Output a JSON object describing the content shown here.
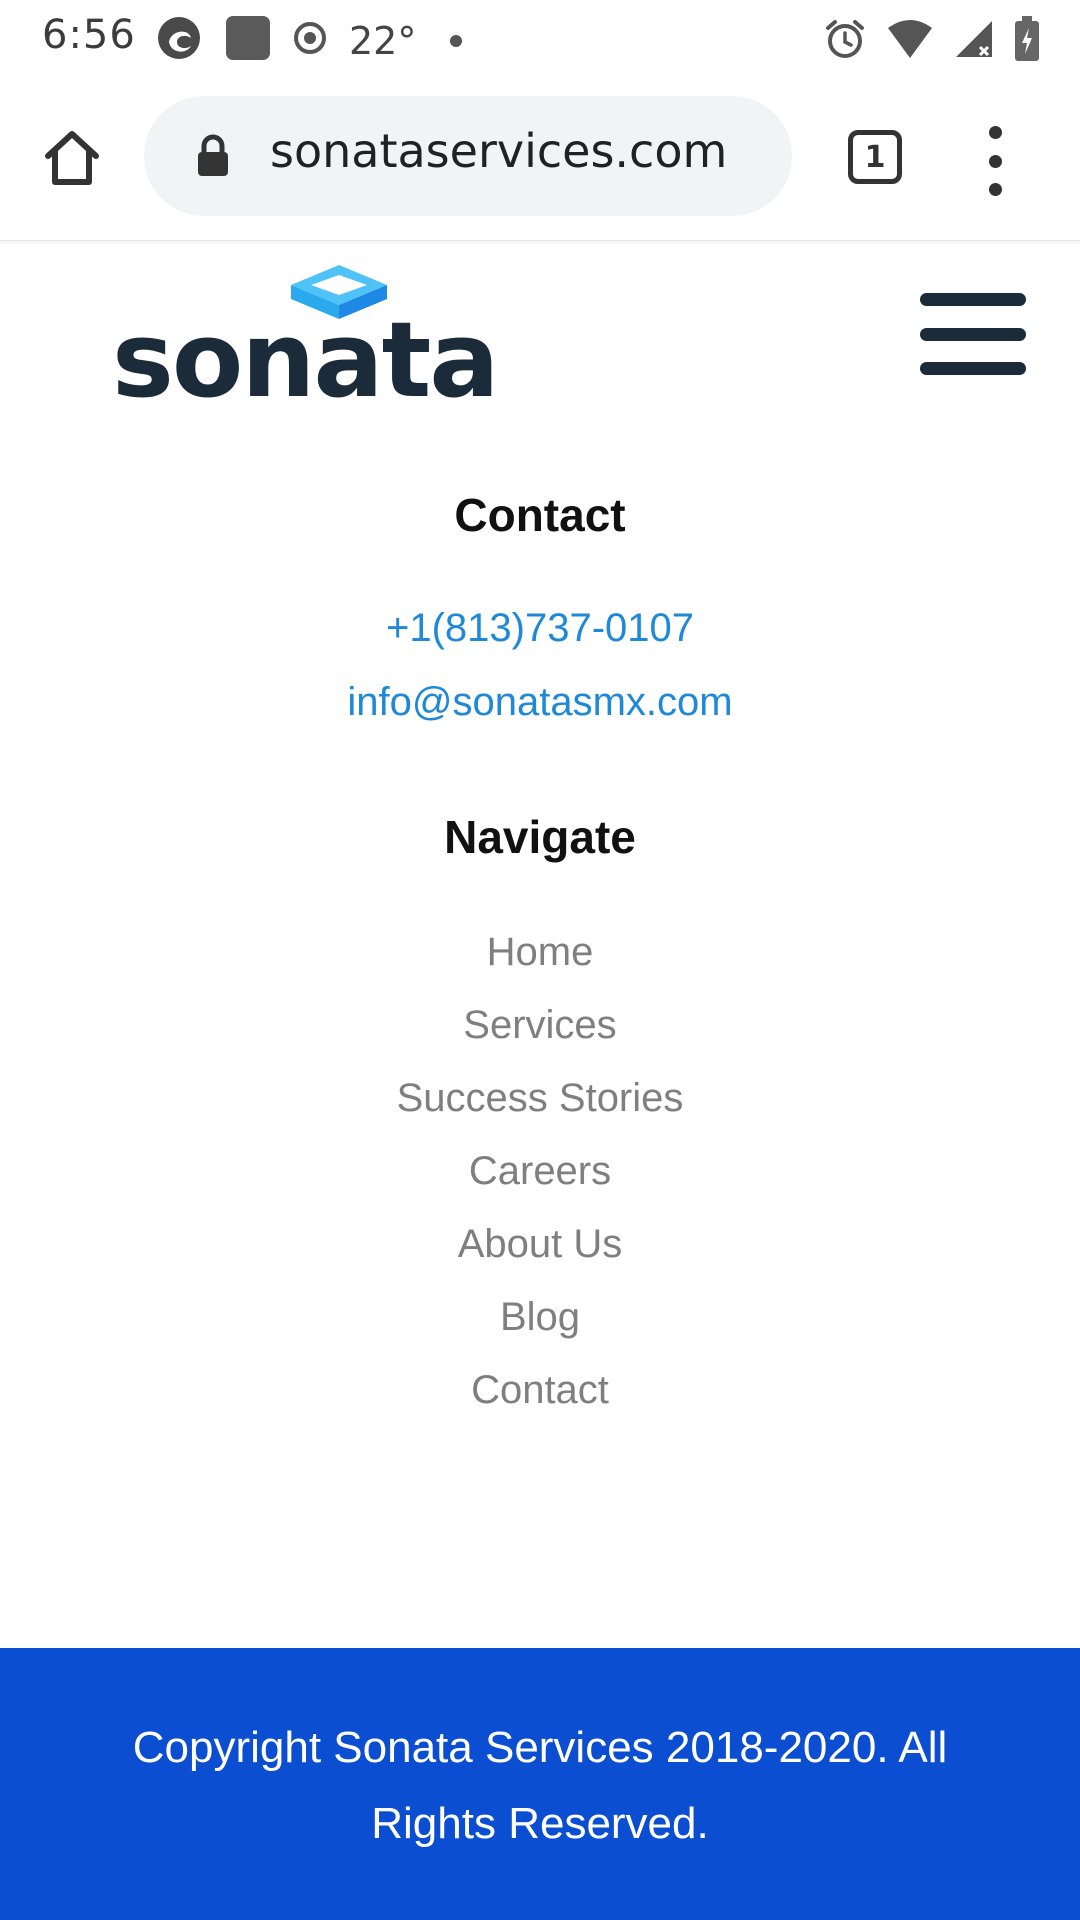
{
  "status_bar": {
    "time": "6:56",
    "temperature": "22°",
    "left_icons": [
      "edge-browser-icon",
      "app-square-icon",
      "record-icon"
    ],
    "right_icons": [
      "alarm-icon",
      "wifi-icon",
      "cell-signal-icon",
      "battery-charging-icon"
    ]
  },
  "browser": {
    "url": "sonataservices.com",
    "tab_count": "1"
  },
  "header": {
    "logo_text": "sonata",
    "brand_colors": {
      "dark": "#1c2b3a",
      "light_blue": "#4fc3f7",
      "blue": "#1e88e5"
    }
  },
  "contact": {
    "heading": "Contact",
    "phone": "+1(813)737-0107",
    "email": "info@sonatasmx.com"
  },
  "navigate": {
    "heading": "Navigate",
    "items": [
      {
        "label": "Home"
      },
      {
        "label": "Services"
      },
      {
        "label": "Success Stories"
      },
      {
        "label": "Careers"
      },
      {
        "label": "About Us"
      },
      {
        "label": "Blog"
      },
      {
        "label": "Contact"
      }
    ]
  },
  "footer": {
    "line1": "Copyright Sonata Services 2018-2020. All",
    "line2": "Rights Reserved.",
    "background_color": "#0b4ed1"
  }
}
